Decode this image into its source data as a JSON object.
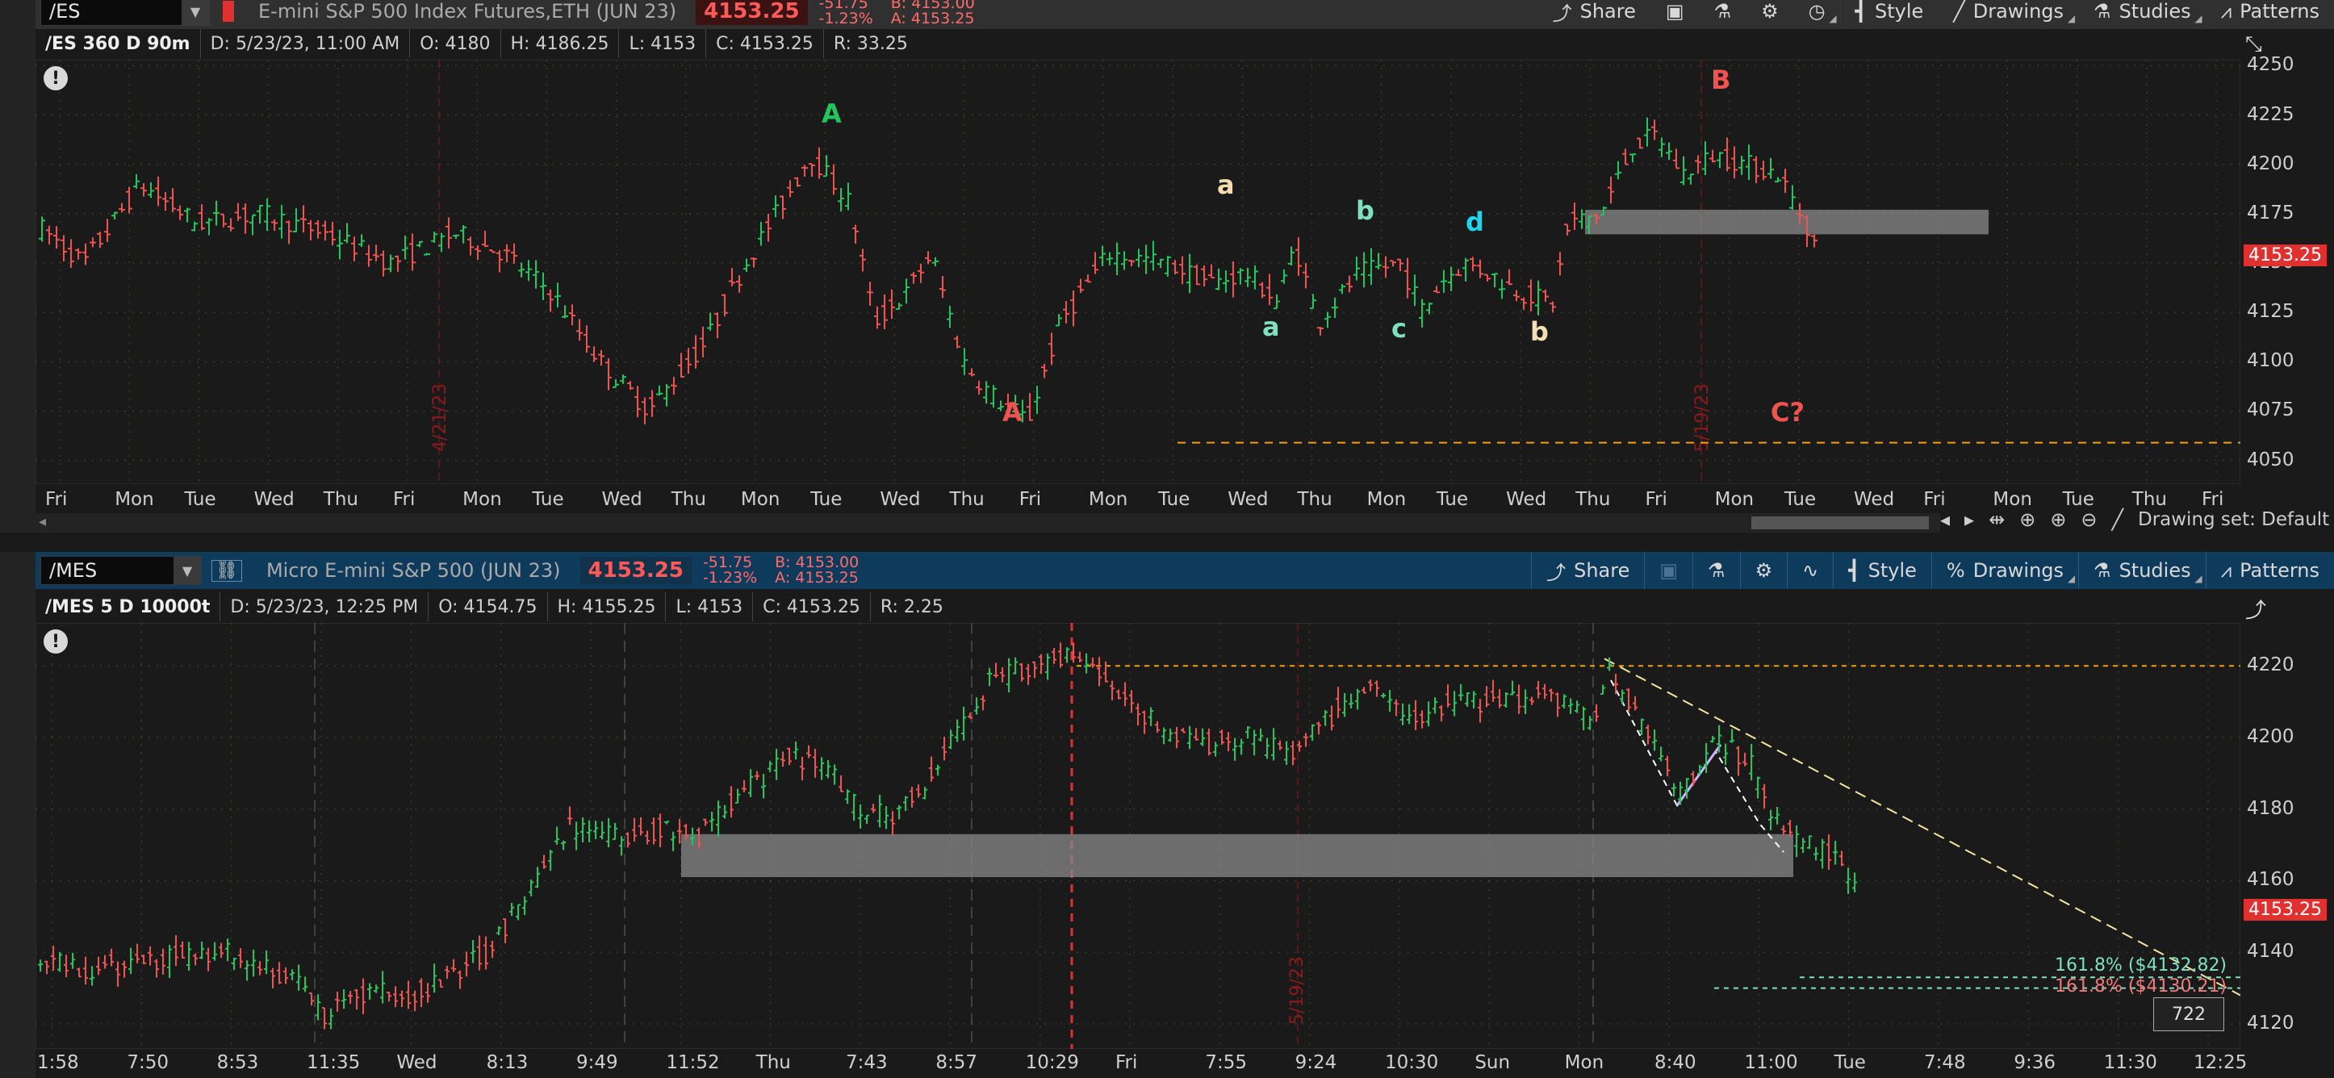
{
  "top": {
    "symbol": "/ES",
    "description": "E-mini S&P 500 Index Futures,ETH (JUN 23)",
    "price": "4153.25",
    "change": "-51.75",
    "change_pct": "-1.23%",
    "bid": "B: 4153.00",
    "ask": "A: 4153.25",
    "toolbar": {
      "share": "Share",
      "style": "Style",
      "drawings": "Drawings",
      "studies": "Studies",
      "patterns": "Patterns"
    },
    "info": {
      "aggregation": "/ES 360 D 90m",
      "date": "D: 5/23/23, 11:00 AM",
      "open": "O: 4180",
      "high": "H: 4186.25",
      "low": "L: 4153",
      "close": "C: 4153.25",
      "range": "R: 33.25"
    },
    "price_tag": "4153.25",
    "y_ticks": [
      "4250",
      "4225",
      "4200",
      "4175",
      "4150",
      "4125",
      "4100",
      "4075",
      "4050"
    ],
    "x_ticks": [
      "Fri",
      "Mon",
      "Tue",
      "Wed",
      "Thu",
      "Fri",
      "Mon",
      "Tue",
      "Wed",
      "Thu",
      "Mon",
      "Tue",
      "Wed",
      "Thu",
      "Fri",
      "Mon",
      "Tue",
      "Wed",
      "Thu",
      "Mon",
      "Tue",
      "Wed",
      "Thu",
      "Fri",
      "Mon",
      "Tue",
      "Wed",
      "Fri",
      "Mon",
      "Tue",
      "Thu",
      "Fri"
    ],
    "date_markers": [
      "4/21/23",
      "5/19/23"
    ],
    "wave_labels": [
      {
        "text": "A",
        "color": "#22c55e"
      },
      {
        "text": "A",
        "color": "#ef5350"
      },
      {
        "text": "a",
        "color": "#f5deb3"
      },
      {
        "text": "a",
        "color": "#7fe0c0"
      },
      {
        "text": "b",
        "color": "#7fe0c0"
      },
      {
        "text": "c",
        "color": "#7fe0c0"
      },
      {
        "text": "d",
        "color": "#22d3ee"
      },
      {
        "text": "b",
        "color": "#f5deb3"
      },
      {
        "text": "B",
        "color": "#ef5350"
      },
      {
        "text": "C?",
        "color": "#ef5350"
      }
    ],
    "drawing_set": "Drawing set: Default"
  },
  "bottom": {
    "symbol": "/MES",
    "description": "Micro E-mini S&P 500 (JUN 23)",
    "price": "4153.25",
    "change": "-51.75",
    "change_pct": "-1.23%",
    "bid": "B: 4153.00",
    "ask": "A: 4153.25",
    "toolbar": {
      "share": "Share",
      "style": "Style",
      "drawings": "Drawings",
      "studies": "Studies",
      "patterns": "Patterns"
    },
    "info": {
      "aggregation": "/MES 5 D 10000t",
      "date": "D: 5/23/23, 12:25 PM",
      "open": "O: 4154.75",
      "high": "H: 4155.25",
      "low": "L: 4153",
      "close": "C: 4153.25",
      "range": "R: 2.25"
    },
    "price_tag": "4153.25",
    "y_ticks": [
      "4220",
      "4200",
      "4180",
      "4160",
      "4140",
      "4120"
    ],
    "x_ticks": [
      "1:58",
      "7:50",
      "8:53",
      "11:35",
      "Wed",
      "8:13",
      "9:49",
      "11:52",
      "Thu",
      "7:43",
      "8:57",
      "10:29",
      "Fri",
      "7:55",
      "9:24",
      "10:30",
      "Sun",
      "Mon",
      "8:40",
      "11:00",
      "Tue",
      "7:48",
      "9:36",
      "11:30",
      "12:25"
    ],
    "date_marker": "5/19/23",
    "fib1": "161.8% ($4132.82)",
    "fib2": "161.8% ($4130.21)",
    "volume_box": "722"
  },
  "colors": {
    "up": "#22c55e",
    "down": "#ef5350",
    "price": "#e03030",
    "orange": "#f59e0b",
    "zone": "#8a8a8a"
  }
}
